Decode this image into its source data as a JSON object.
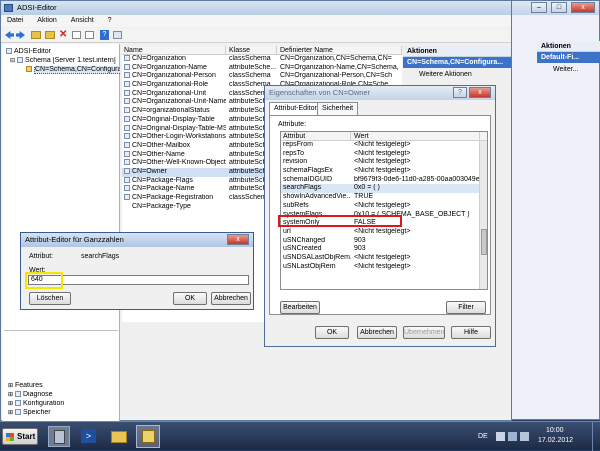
{
  "desktop": {
    "bg": "#2a3d68"
  },
  "adsi": {
    "title": "ADSI-Editor",
    "menu": [
      "Datei",
      "Aktion",
      "Ansicht",
      "?"
    ],
    "tree": [
      {
        "label": "ADSI-Editor",
        "indent": 0
      },
      {
        "label": "Schema [Server 1.test.intern]",
        "indent": 1
      },
      {
        "label": "CN=Schema,CN=Configura",
        "indent": 2,
        "selected": true
      }
    ],
    "tree_bottom": [
      "Features",
      "Diagnose",
      "Konfiguration",
      "Speicher"
    ],
    "columns": [
      "Name",
      "Klasse",
      "Definierter Name"
    ],
    "rows": [
      [
        "CN=Organization",
        "classSchema",
        "CN=Organization,CN=Schema,CN="
      ],
      [
        "CN=Organization-Name",
        "attributeSche...",
        "CN=Organization-Name,CN=Schema,"
      ],
      [
        "CN=Organizational-Person",
        "classSchema",
        "CN=Organizational-Person,CN=Sch"
      ],
      [
        "CN=Organizational-Role",
        "classSchema",
        "CN=Organizational-Role,CN=Sche"
      ],
      [
        "CN=Organizational-Unit",
        "classSchema",
        "CN=Organizational-Unit,CN=Schem"
      ],
      [
        "CN=Organizational-Unit-Name",
        "attributeSche...",
        "CN=Organizational-Unit-Name,CN="
      ],
      [
        "CN=organizationalStatus",
        "attributeSche...",
        ""
      ],
      [
        "CN=Original-Display-Table",
        "attributeSche...",
        ""
      ],
      [
        "CN=Original-Display-Table-MS...",
        "attributeSche...",
        ""
      ],
      [
        "CN=Other-Login-Workstations",
        "attributeSche...",
        ""
      ],
      [
        "CN=Other-Mailbox",
        "attributeSche...",
        ""
      ],
      [
        "CN=Other-Name",
        "attributeSche...",
        ""
      ],
      [
        "CN=Other-Well-Known-Objects",
        "attributeSche...",
        ""
      ],
      [
        "CN=Owner",
        "attributeSche...",
        ""
      ],
      [
        "CN=Package-Flags",
        "attributeSche...",
        ""
      ],
      [
        "CN=Package-Name",
        "attributeSche...",
        ""
      ],
      [
        "CN=Package-Registration",
        "classSchema",
        ""
      ]
    ],
    "row_tail": "CN=Package-Type",
    "actions_title": "Aktionen",
    "actions_selected": "CN=Schema,CN=Configura...",
    "actions_more": "Weitere Aktionen"
  },
  "back_window": {
    "actions_title": "Aktionen",
    "actions_selected": "Default-Fi...",
    "actions_more": "Weiter..."
  },
  "props": {
    "title": "Eigenschaften von CN=Owner",
    "tabs": [
      "Attribut-Editor",
      "Sicherheit"
    ],
    "attr_label": "Attribute:",
    "columns": [
      "Attribut",
      "Wert"
    ],
    "rows": [
      [
        "repsFrom",
        "<Nicht festgelegt>"
      ],
      [
        "repsTo",
        "<Nicht festgelegt>"
      ],
      [
        "revision",
        "<Nicht festgelegt>"
      ],
      [
        "schemaFlagsEx",
        "<Nicht festgelegt>"
      ],
      [
        "schemaIDGUID",
        "bf9679f3-0de6-11d0-a285-00aa003049e2"
      ],
      [
        "searchFlags",
        "0x0 = ( )"
      ],
      [
        "showInAdvancedVie...",
        "TRUE"
      ],
      [
        "subRefs",
        "<Nicht festgelegt>"
      ],
      [
        "systemFlags",
        "0x10 = ( SCHEMA_BASE_OBJECT )"
      ],
      [
        "systemOnly",
        "FALSE"
      ],
      [
        "url",
        "<Nicht festgelegt>"
      ],
      [
        "uSNChanged",
        "903"
      ],
      [
        "uSNCreated",
        "903"
      ],
      [
        "uSNDSALastObjRem...",
        "<Nicht festgelegt>"
      ],
      [
        "uSNLastObjRem",
        "<Nicht festgelegt>"
      ]
    ],
    "edit_btn": "Bearbeiten",
    "filter_btn": "Filter",
    "ok": "OK",
    "cancel": "Abbrechen",
    "apply": "Übernehmen",
    "help": "Hilfe",
    "highlight_color": "#e0161b"
  },
  "int_editor": {
    "title": "Attribut-Editor für Ganzzahlen",
    "attr_label": "Attribut:",
    "attr_value": "searchFlags",
    "value_label": "Wert:",
    "value": "640",
    "clear": "Löschen",
    "ok": "OK",
    "cancel": "Abbrechen",
    "highlight_color": "#f5e600"
  },
  "taskbar": {
    "start": "Start",
    "lang": "DE",
    "time": "10:00",
    "date": "17.02.2012"
  }
}
